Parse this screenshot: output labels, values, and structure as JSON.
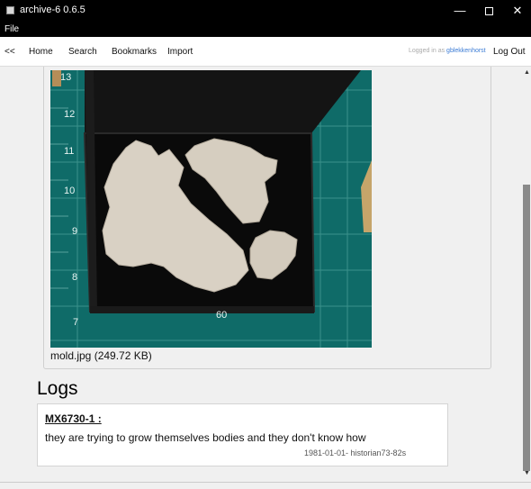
{
  "window": {
    "title": "archive-6 0.6.5",
    "minimize_glyph": "—",
    "close_glyph": "✕"
  },
  "menu": {
    "file": "File"
  },
  "nav": {
    "back": "<<",
    "home": "Home",
    "search": "Search",
    "bookmarks": "Bookmarks",
    "import": "Import",
    "logged_in_prefix": "Logged in as",
    "user": "gblekkenhorst",
    "logout": "Log Out"
  },
  "attachment": {
    "caption": "mold.jpg (249.72 KB)",
    "ruler_numbers": [
      "13",
      "12",
      "11",
      "10",
      "9",
      "8",
      "7"
    ],
    "ruler_bottom": "60"
  },
  "logs": {
    "heading": "Logs",
    "entries": [
      {
        "id": "MX6730-1 :",
        "text": "they are trying to grow themselves bodies and they don't know how",
        "meta": "1981-01-01- historian73-82s"
      }
    ]
  },
  "scrollbar": {
    "up": "▲",
    "down": "▼"
  }
}
